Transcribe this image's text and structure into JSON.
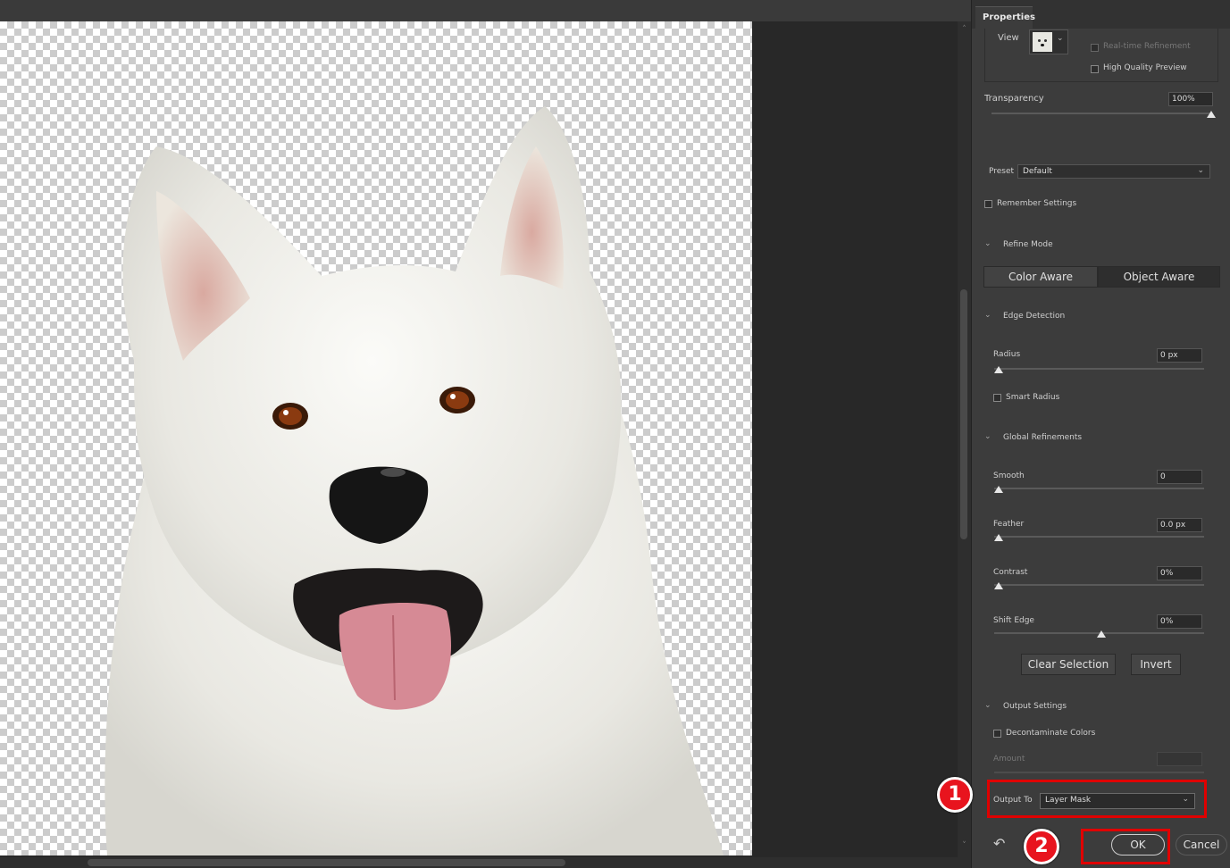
{
  "panel": {
    "title": "Properties",
    "view_label": "View",
    "realtime_refinement_label": "Real-time Refinement",
    "high_quality_preview_label": "High Quality Preview",
    "transparency_label": "Transparency",
    "transparency_value": "100%",
    "transparency_fraction": 1.0,
    "preset_label": "Preset",
    "preset_value": "Default",
    "remember_settings_label": "Remember Settings",
    "refine_mode_section": "Refine Mode",
    "color_aware_label": "Color Aware",
    "object_aware_label": "Object Aware",
    "edge_detection_section": "Edge Detection",
    "radius_label": "Radius",
    "radius_value": "0 px",
    "smart_radius_label": "Smart Radius",
    "global_refinements_section": "Global Refinements",
    "smooth_label": "Smooth",
    "smooth_value": "0",
    "feather_label": "Feather",
    "feather_value": "0.0 px",
    "contrast_label": "Contrast",
    "contrast_value": "0%",
    "shift_edge_label": "Shift Edge",
    "shift_edge_value": "0%",
    "clear_selection_label": "Clear Selection",
    "invert_label": "Invert",
    "output_settings_section": "Output Settings",
    "decontaminate_label": "Decontaminate Colors",
    "amount_label": "Amount",
    "output_to_label": "Output To",
    "output_to_value": "Layer Mask",
    "ok_label": "OK",
    "cancel_label": "Cancel"
  },
  "annotations": {
    "step1": "1",
    "step2": "2",
    "highlight_color": "#e00000"
  },
  "canvas": {
    "subject": "white dog on transparent background"
  }
}
